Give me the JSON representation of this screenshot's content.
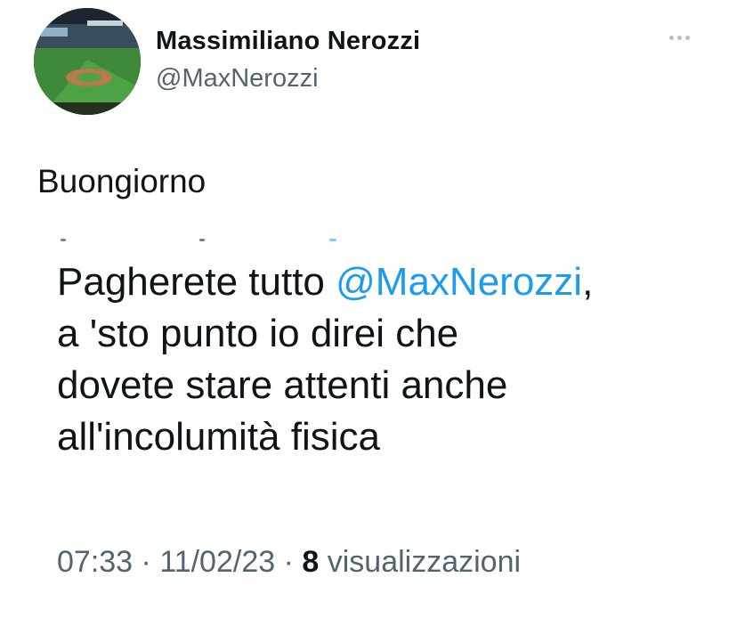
{
  "author": {
    "display_name": "Massimiliano Nerozzi",
    "handle": "@MaxNerozzi",
    "avatar_icon": "baseball-stadium-photo"
  },
  "more_menu": {
    "icon": "more-horizontal-icon"
  },
  "tweet": {
    "text": "Buongiorno"
  },
  "quoted_image": {
    "line1_prefix": "Pagherete tutto ",
    "line1_mention": "@MaxNerozzi",
    "line1_suffix": ",",
    "line2": "a 'sto punto io direi che",
    "line3": "dovete stare attenti anche",
    "line4": "all'incolumità fisica"
  },
  "meta": {
    "time": "07:33",
    "sep1": " · ",
    "date": "11/02/23",
    "sep2": " · ",
    "views_count": "8",
    "views_label": " visualizzazioni"
  },
  "colors": {
    "text": "#0f1419",
    "secondary": "#536471",
    "mention": "#1d9bf0"
  }
}
